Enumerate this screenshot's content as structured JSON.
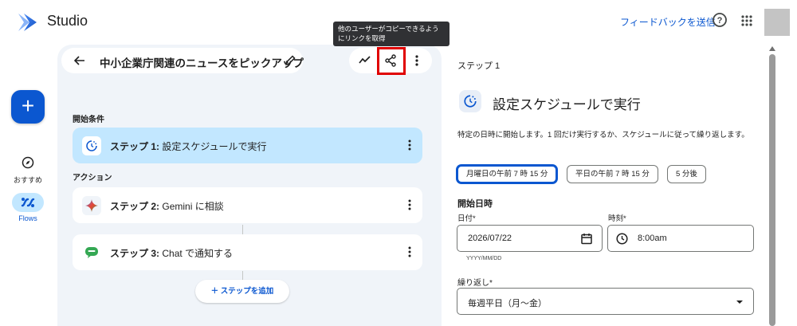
{
  "app": {
    "name": "Studio"
  },
  "header": {
    "feedback_label": "フィードバックを送信",
    "help_icon": "help-circle-icon",
    "apps_icon": "apps-grid-icon"
  },
  "rail": {
    "create_label": "+",
    "items": [
      {
        "label": "おすすめ",
        "icon": "compass-icon"
      },
      {
        "label": "Flows",
        "icon": "flows-icon"
      }
    ]
  },
  "flow": {
    "title": "中小企業庁関連のニュースをピックアップ",
    "tooltip": "他のユーザーがコピーできるようにリンクを取得",
    "start_section": "開始条件",
    "action_section": "アクション",
    "steps": [
      {
        "number": "ステップ 1:",
        "text": "設定スケジュールで実行",
        "icon": "schedule-icon"
      },
      {
        "number": "ステップ 2:",
        "text": "Gemini に相談",
        "icon": "gemini-icon"
      },
      {
        "number": "ステップ 3:",
        "text": "Chat で通知する",
        "icon": "chat-icon"
      }
    ],
    "add_step_label": "＋  ステップを追加"
  },
  "detail": {
    "step_label": "ステップ 1",
    "heading": "設定スケジュールで実行",
    "description": "特定の日時に開始します。1 回だけ実行するか、スケジュールに従って繰り返します。",
    "chips": [
      {
        "label": "月曜日の午前 7 時 15 分",
        "selected": true
      },
      {
        "label": "平日の午前 7 時 15 分",
        "selected": false
      },
      {
        "label": "5 分後",
        "selected": false
      }
    ],
    "start_datetime_label": "開始日時",
    "date_label": "日付*",
    "date_value": "2026/07/22",
    "date_hint": "YYYY/MM/DD",
    "time_label": "時刻*",
    "time_value": "8:00am",
    "repeat_label": "繰り返し*",
    "repeat_value": "毎週平日（月〜金）"
  },
  "colors": {
    "accent": "#0b57d0",
    "selected_bg": "#c2e7ff",
    "panel_bg": "#f0f4f9",
    "highlight": "#e00000"
  }
}
